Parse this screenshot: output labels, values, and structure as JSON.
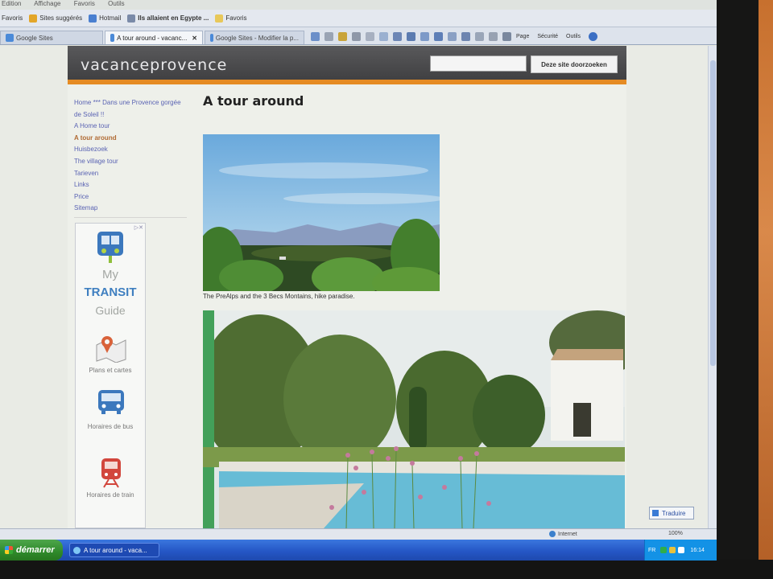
{
  "browser": {
    "menu": [
      "Edition",
      "Affichage",
      "Favoris",
      "Outils"
    ],
    "favorites_bar": [
      "Favoris",
      "Sites suggérés",
      "Hotmail",
      "Ils allaient en Egypte ...",
      "Favoris"
    ],
    "tabs": [
      {
        "label": "Google Sites"
      },
      {
        "label": "A tour around - vacanc..."
      },
      {
        "label": "Google Sites - Modifier la p..."
      }
    ],
    "toolbar_labels": {
      "page": "Page",
      "security": "Sécurité",
      "tools": "Outils"
    },
    "status": {
      "zone": "Internet",
      "zoom": "100%"
    },
    "translate_label": "Traduire"
  },
  "site": {
    "title": "vacanceprovence",
    "search_button": "Deze site doorzoeken",
    "nav": [
      {
        "label": "Home *** Dans une Provence gorgée de Soleil !!"
      },
      {
        "label": "A Home tour"
      },
      {
        "label": "A tour around"
      },
      {
        "label": "Huisbezoek"
      },
      {
        "label": "The village tour"
      },
      {
        "label": "Tarieven"
      },
      {
        "label": "Links"
      },
      {
        "label": "Price"
      },
      {
        "label": "Sitemap"
      }
    ],
    "ad": {
      "my": "My",
      "transit": "TRANSIT",
      "guide": "Guide",
      "links": [
        "Plans et cartes",
        "Horaires de bus",
        "Horaires de train"
      ]
    },
    "page_title": "A tour around",
    "caption1": "The PreAlps and the 3 Becs Montains, hike paradise."
  },
  "taskbar": {
    "start": "démarrer",
    "task": "A tour around - vaca...",
    "tray": {
      "lang": "FR",
      "clock": "16:14"
    }
  }
}
